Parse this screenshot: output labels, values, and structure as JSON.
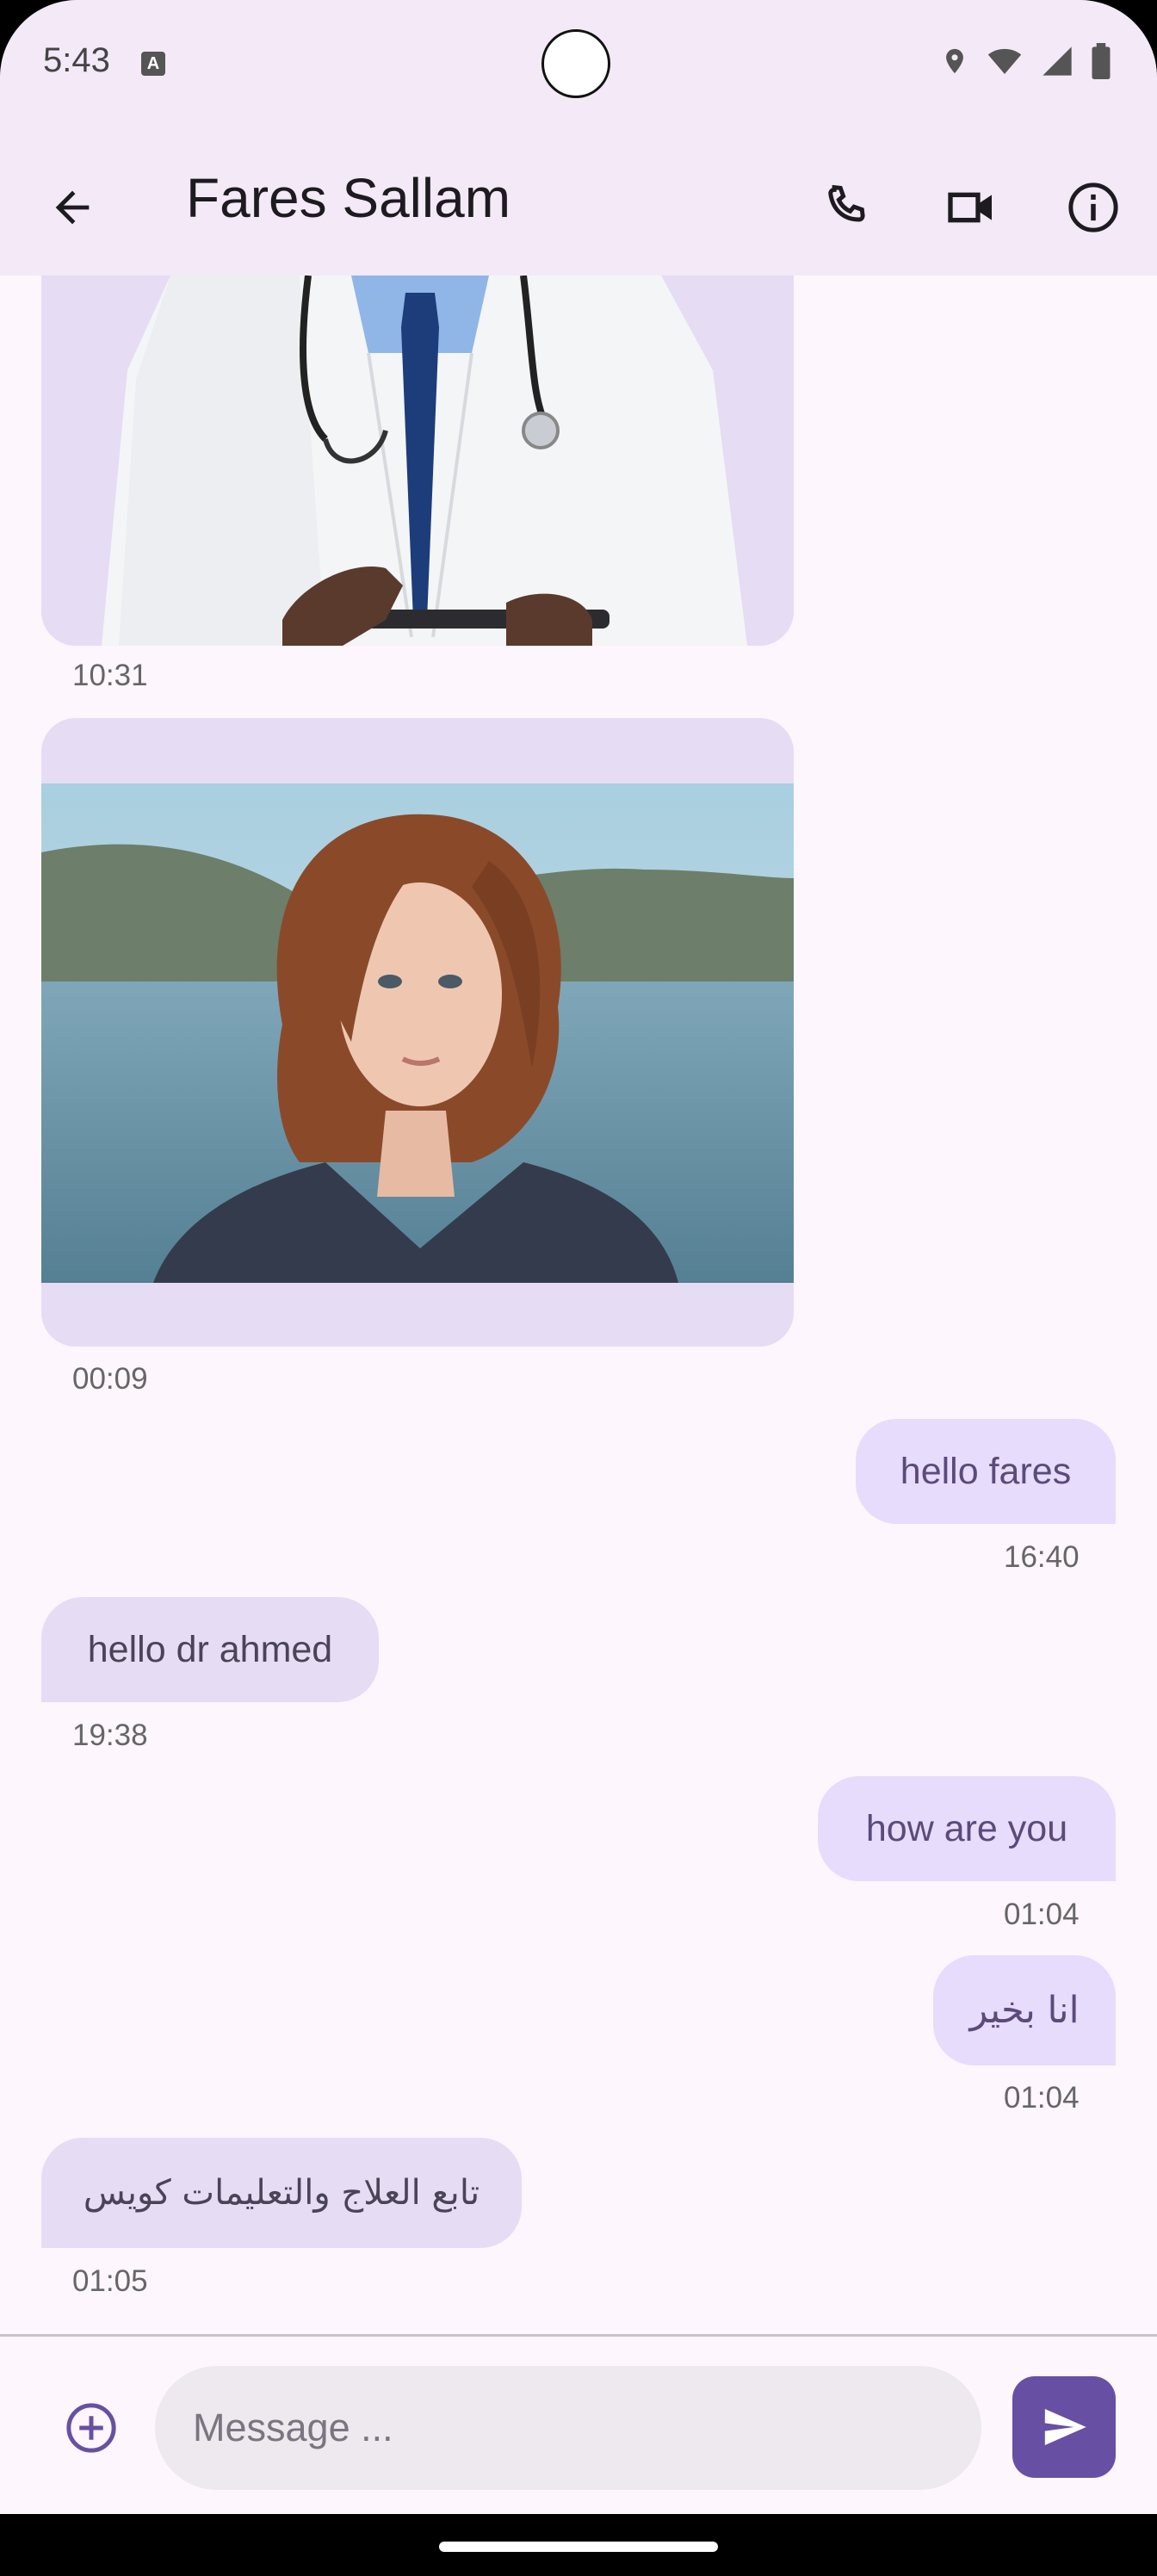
{
  "status_bar": {
    "time": "5:43",
    "notification_badge": "A"
  },
  "header": {
    "title": "Fares Sallam"
  },
  "icons": {
    "back": "arrow-back-icon",
    "call": "phone-icon",
    "video": "videocam-icon",
    "info": "info-icon",
    "attach": "add-circle-icon",
    "send": "send-icon"
  },
  "messages": [
    {
      "type": "image",
      "direction": "incoming",
      "image_desc": "doctor-photo",
      "time": "10:31"
    },
    {
      "type": "image",
      "direction": "incoming",
      "image_desc": "woman-portrait-photo",
      "time": "00:09"
    },
    {
      "type": "text",
      "direction": "outgoing",
      "text": "hello fares",
      "time": "16:40"
    },
    {
      "type": "text",
      "direction": "incoming",
      "text": "hello dr ahmed",
      "time": "19:38"
    },
    {
      "type": "text",
      "direction": "outgoing",
      "text": "how are you",
      "time": "01:04"
    },
    {
      "type": "text",
      "direction": "outgoing",
      "text": "انا بخير",
      "time": "01:04"
    },
    {
      "type": "text",
      "direction": "incoming",
      "text": "تابع العلاج والتعليمات كويس",
      "time": "01:05"
    }
  ],
  "composer": {
    "placeholder": "Message ..."
  },
  "colors": {
    "accent": "#6750a4",
    "outgoing_bubble": "#e7dcfb",
    "incoming_bubble": "#e6dcf4",
    "appbar": "#f3e9f7"
  }
}
